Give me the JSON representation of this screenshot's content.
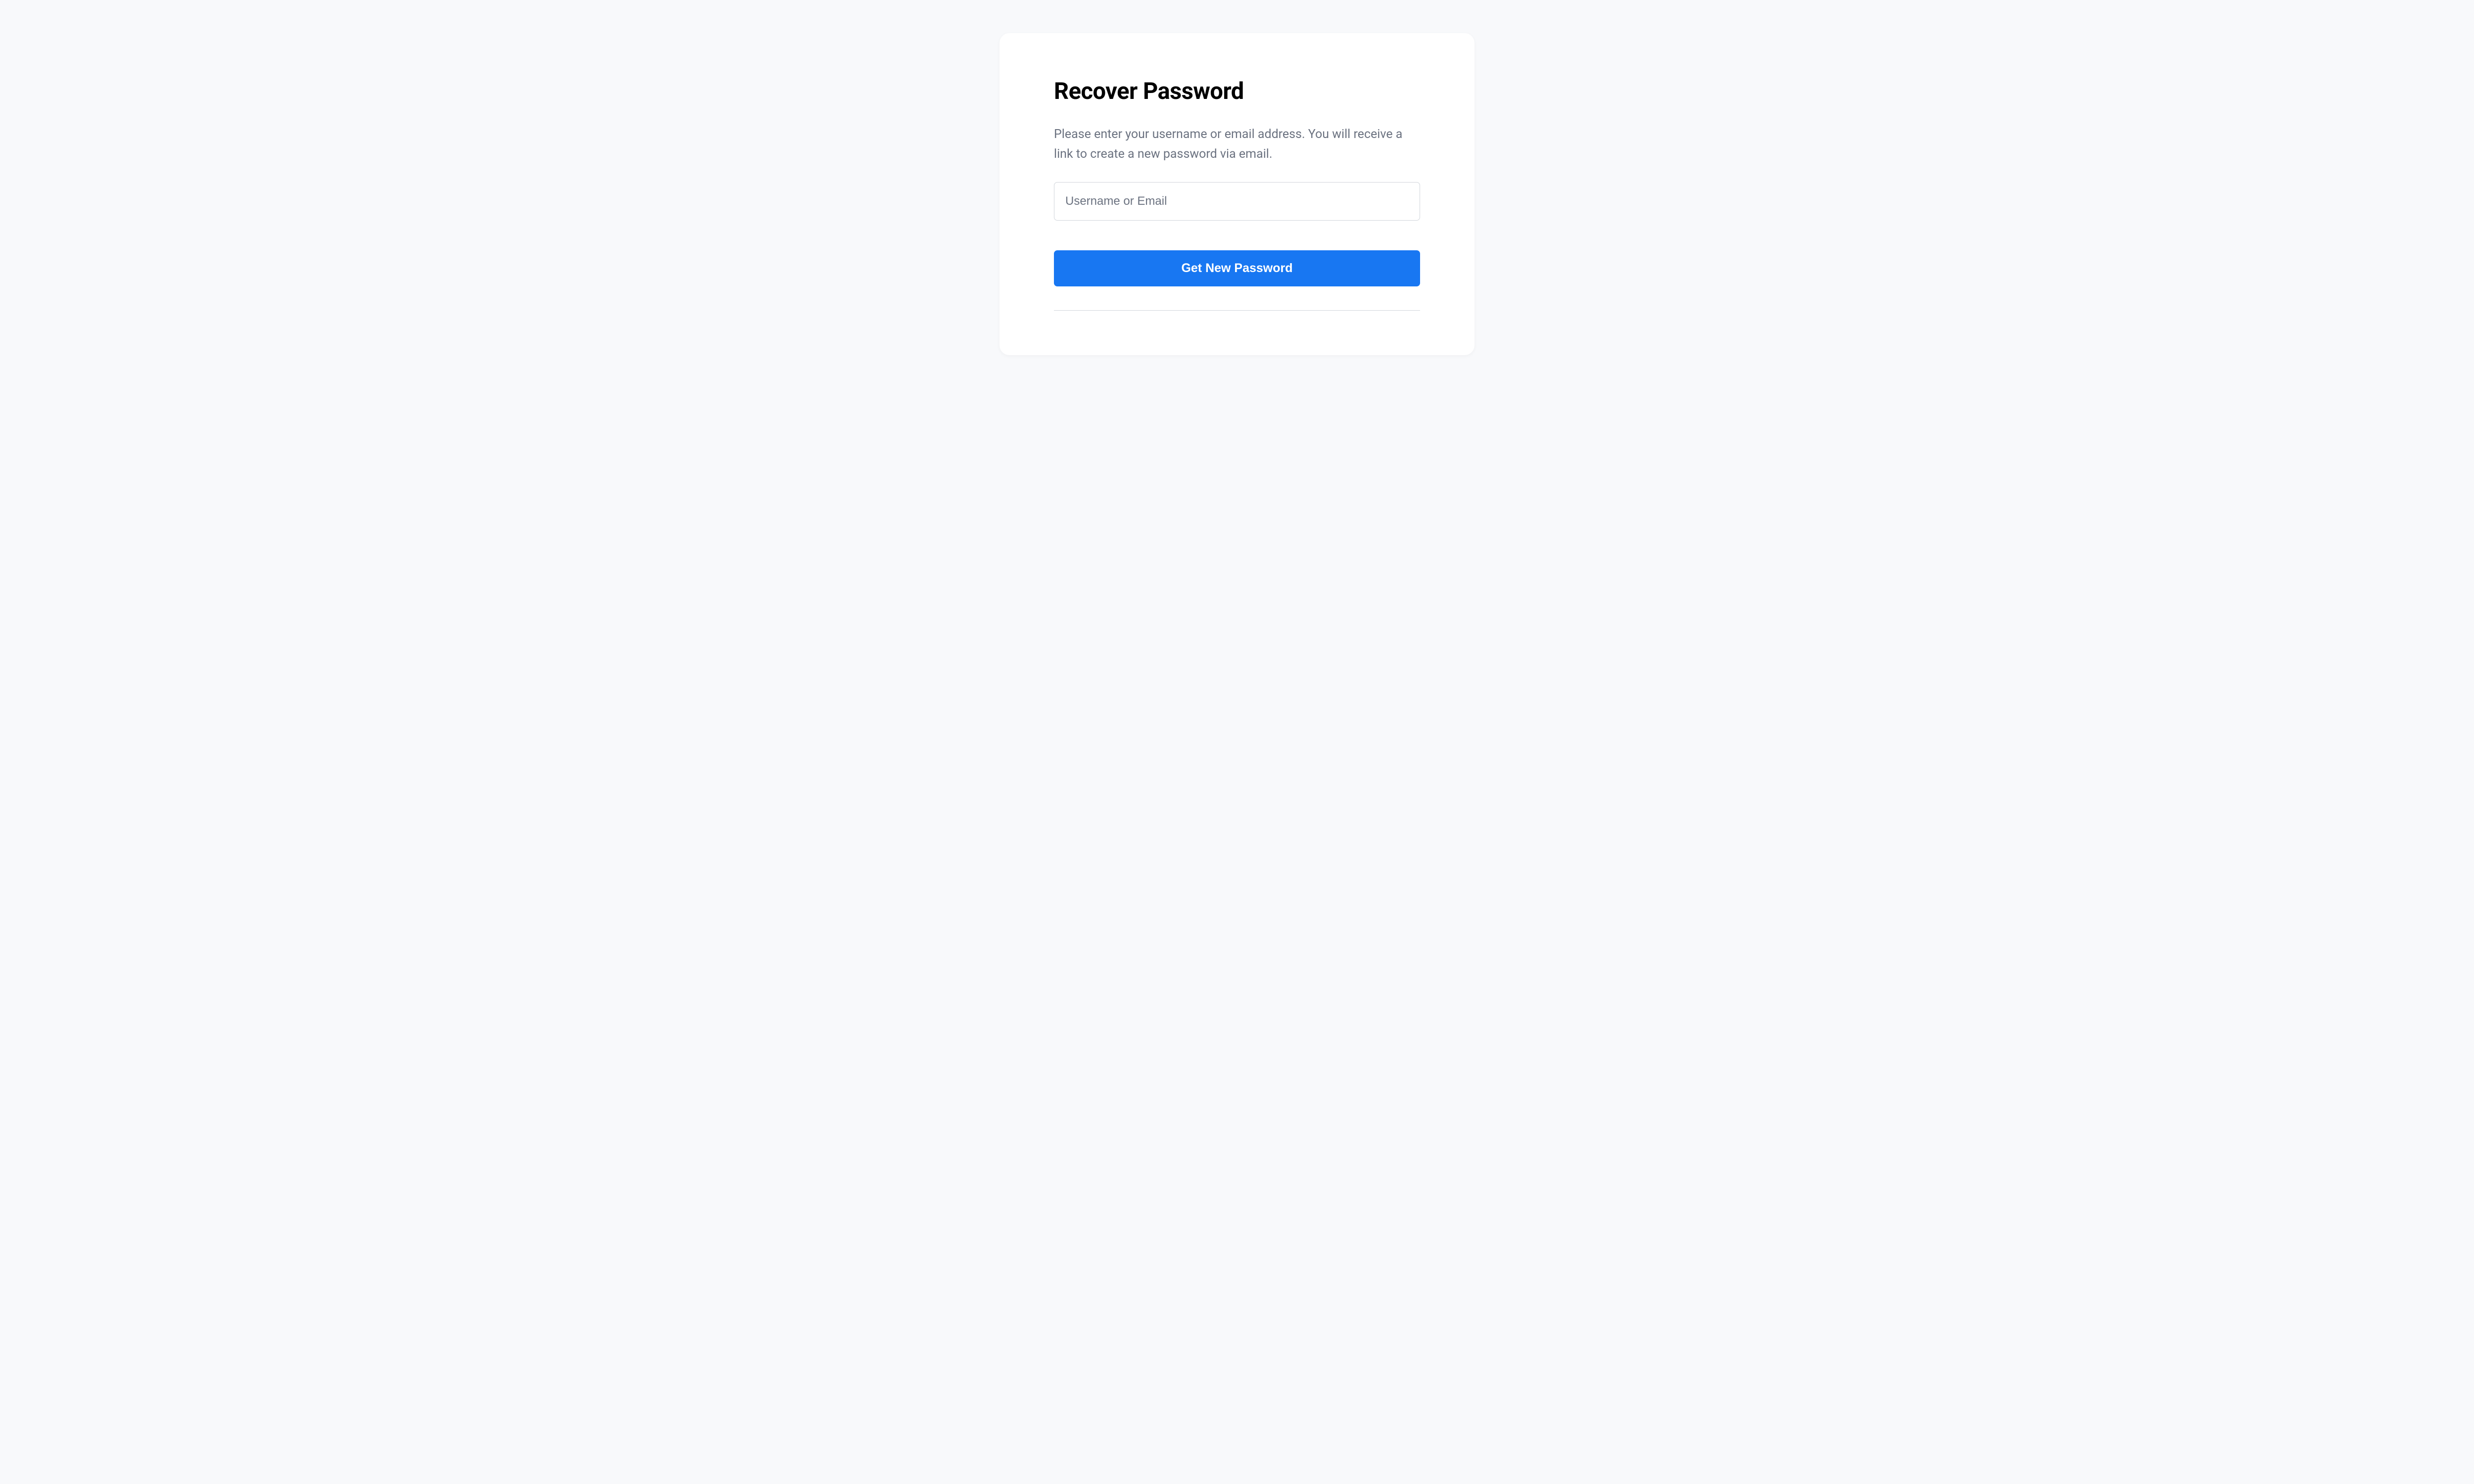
{
  "form": {
    "title": "Recover Password",
    "description": "Please enter your username or email address. You will receive a link to create a new password via email.",
    "input_placeholder": "Username or Email",
    "submit_label": "Get New Password"
  }
}
